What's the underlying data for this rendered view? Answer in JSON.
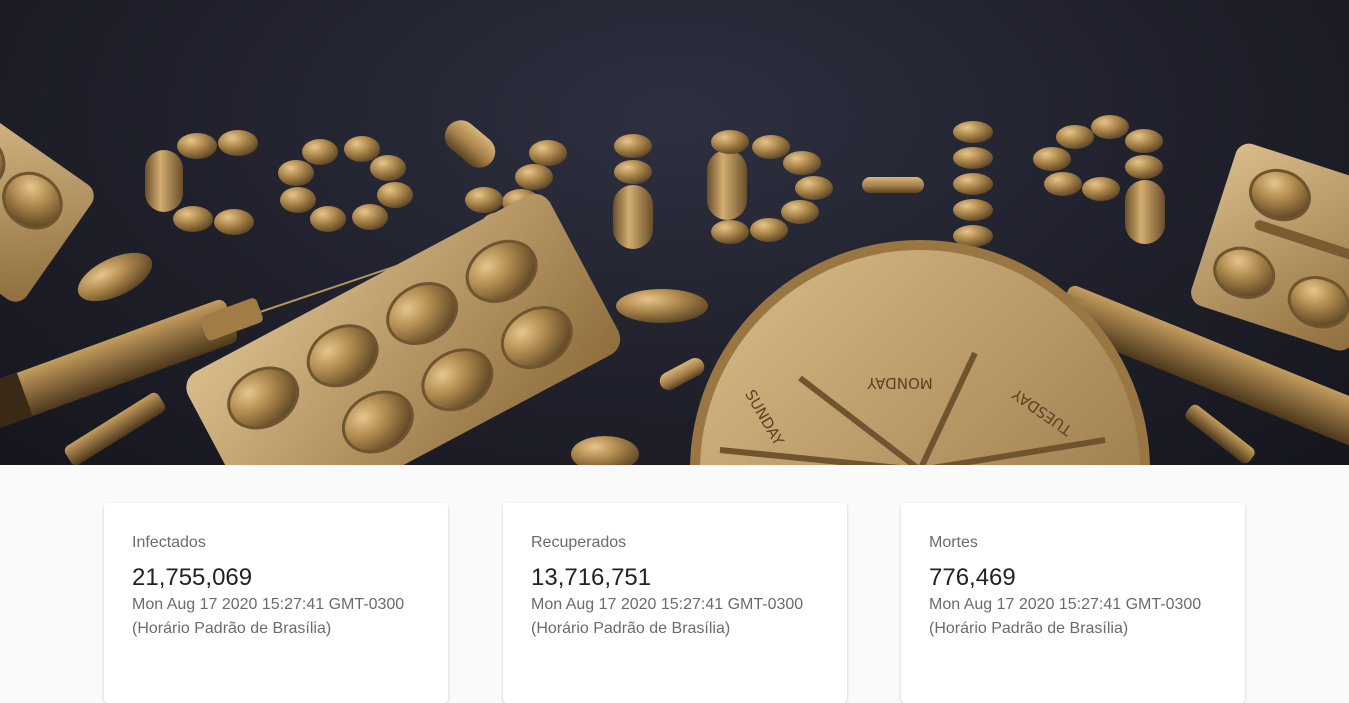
{
  "hero": {
    "image_text": "COVID-19",
    "pill_box_days": [
      "MONDAY",
      "TUESDAY",
      "SUNDAY"
    ]
  },
  "cards": [
    {
      "title": "Infectados",
      "value": "21,755,069",
      "date": "Mon Aug 17 2020 15:27:41 GMT-0300 (Horário Padrão de Brasília)"
    },
    {
      "title": "Recuperados",
      "value": "13,716,751",
      "date": "Mon Aug 17 2020 15:27:41 GMT-0300 (Horário Padrão de Brasília)"
    },
    {
      "title": "Mortes",
      "value": "776,469",
      "date": "Mon Aug 17 2020 15:27:41 GMT-0300 (Horário Padrão de Brasília)"
    }
  ],
  "colors": {
    "gold": "#b08a4e",
    "gold_light": "#d7b57a",
    "background_dark": "#1f202b",
    "page_bg": "#fafafa"
  }
}
